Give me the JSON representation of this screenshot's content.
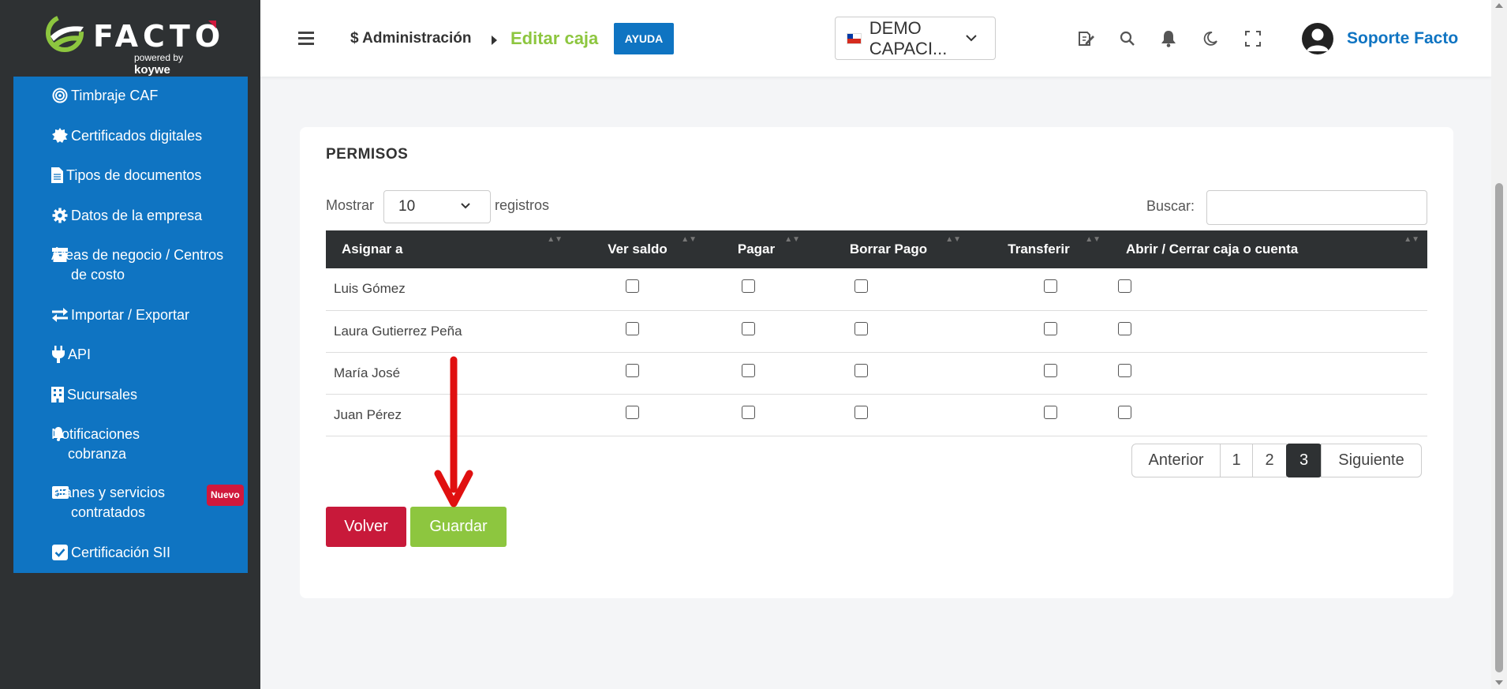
{
  "brand": {
    "logo_text": "FACTO",
    "powered_label": "powered",
    "by_label": "by",
    "powered_brand": "koywe",
    "accent_color": "#8dc63f",
    "sidebar_menu_color": "#0f74c2"
  },
  "sidebar": {
    "items": [
      {
        "label": "Timbraje CAF",
        "icon": "target-icon"
      },
      {
        "label": "Certificados digitales",
        "icon": "certificate-icon"
      },
      {
        "label": "Tipos de documentos",
        "icon": "document-icon"
      },
      {
        "label": "Datos de la empresa",
        "icon": "gear-icon"
      },
      {
        "label": "Áreas de negocio / Centros de costo",
        "icon": "archive-icon"
      },
      {
        "label": "Importar / Exportar",
        "icon": "exchange-icon"
      },
      {
        "label": "API",
        "icon": "plug-icon"
      },
      {
        "label": "Sucursales",
        "icon": "building-icon"
      },
      {
        "label": "Notificaciones cobranza",
        "icon": "bell-icon"
      },
      {
        "label": "Planes y servicios contratados",
        "icon": "money-card-icon",
        "badge": "Nuevo"
      },
      {
        "label": "Certificación SII",
        "icon": "check-square-icon"
      }
    ]
  },
  "header": {
    "breadcrumb_root": "$ Administración",
    "breadcrumb_current": "Editar caja",
    "help_label": "AYUDA",
    "company": "DEMO CAPACI...",
    "user_name": "Soporte Facto",
    "icons": [
      "edit-icon",
      "search-icon",
      "bell-icon",
      "moon-icon",
      "fullscreen-icon"
    ]
  },
  "permissions": {
    "title": "PERMISOS",
    "show_label": "Mostrar",
    "show_value": "10",
    "show_suffix": "registros",
    "search_label": "Buscar:",
    "search_value": "",
    "columns": [
      "Asignar a",
      "Ver saldo",
      "Pagar",
      "Borrar Pago",
      "Transferir",
      "Abrir / Cerrar caja o cuenta"
    ],
    "rows": [
      {
        "name": "Luis Gómez",
        "checks": [
          false,
          false,
          false,
          false,
          false
        ]
      },
      {
        "name": "Laura Gutierrez Peña",
        "checks": [
          false,
          false,
          false,
          false,
          false
        ]
      },
      {
        "name": "María José",
        "checks": [
          false,
          false,
          false,
          false,
          false
        ]
      },
      {
        "name": "Juan Pérez",
        "checks": [
          false,
          false,
          false,
          false,
          false
        ]
      }
    ],
    "pagination": {
      "prev_label": "Anterior",
      "pages": [
        "1",
        "2",
        "3"
      ],
      "current_page": "3",
      "next_label": "Siguiente"
    },
    "back_label": "Volver",
    "save_label": "Guardar"
  }
}
